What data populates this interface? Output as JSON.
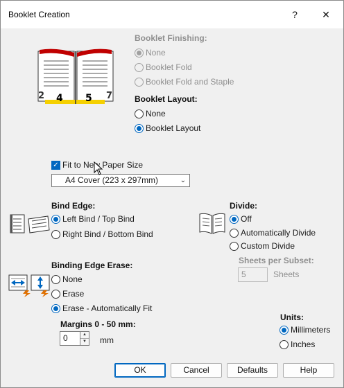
{
  "window": {
    "title": "Booklet Creation",
    "help_glyph": "?",
    "close_glyph": "✕"
  },
  "booklet_finishing": {
    "label": "Booklet Finishing:",
    "options": [
      "None",
      "Booklet Fold",
      "Booklet Fold and Staple"
    ],
    "selected": 0,
    "disabled": true
  },
  "booklet_layout": {
    "label": "Booklet Layout:",
    "options": [
      "None",
      "Booklet Layout"
    ],
    "selected": 1
  },
  "preview_pages": {
    "far_left": "2",
    "left": "4",
    "right": "5",
    "far_right": "7"
  },
  "fit_paper": {
    "label": "Fit to New Paper Size",
    "checked": true,
    "selected_size": "A4 Cover (223 x 297mm)"
  },
  "bind_edge": {
    "label": "Bind Edge:",
    "options": [
      "Left Bind / Top Bind",
      "Right Bind / Bottom Bind"
    ],
    "selected": 0
  },
  "divide": {
    "label": "Divide:",
    "options": [
      "Off",
      "Automatically Divide",
      "Custom Divide"
    ],
    "selected": 0,
    "sheets_per_subset_label": "Sheets per Subset:",
    "sheets_value": "5",
    "sheets_unit": "Sheets"
  },
  "binding_edge_erase": {
    "label": "Binding Edge Erase:",
    "options": [
      "None",
      "Erase",
      "Erase - Automatically Fit"
    ],
    "selected": 2
  },
  "margins": {
    "label": "Margins 0 - 50 mm:",
    "value": "0",
    "unit": "mm"
  },
  "units": {
    "label": "Units:",
    "options": [
      "Millimeters",
      "Inches"
    ],
    "selected": 0
  },
  "buttons": {
    "ok": "OK",
    "cancel": "Cancel",
    "defaults": "Defaults",
    "help": "Help"
  },
  "colors": {
    "accent": "#0067c0",
    "disabled_text": "#8f8f8f",
    "book_red": "#c00000",
    "book_yellow": "#f5d000"
  }
}
